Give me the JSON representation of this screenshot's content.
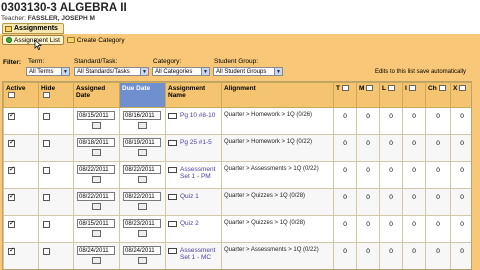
{
  "header": {
    "course_title": "0303130-3 ALGEBRA II",
    "teacher_label": "Teacher: ",
    "teacher_name": "FASSLER, JOSEPH M",
    "tab_label": "Assignments"
  },
  "toolbar": {
    "assignment_list_label": "Assignment List",
    "create_category_label": "Create Category"
  },
  "filters": {
    "filter_label": "Filter:",
    "term_label": "Term:",
    "term_value": "All Terms",
    "standard_label": "Standard/Task:",
    "standard_value": "All Standards/Tasks",
    "category_label": "Category:",
    "category_value": "All Categories",
    "group_label": "Student Group:",
    "group_value": "All Student Groups",
    "note": "Edits to this list save automatically"
  },
  "columns": {
    "active": "Active",
    "hide": "Hide",
    "assigned": "Assigned Date",
    "due": "Due Date",
    "assignment": "Assignment Name",
    "alignment": "Alignment",
    "t": "T",
    "m": "M",
    "l": "L",
    "i": "I",
    "ch": "Ch",
    "x": "X"
  },
  "rows": [
    {
      "active": true,
      "hide": false,
      "assigned": "08/15/2011",
      "due": "08/16/2011",
      "name": "Pg 10 #8-10",
      "alignment": "Quarter > Homework > 1Q (0/26)",
      "t": "0",
      "m": "0",
      "l": "0",
      "i": "0",
      "ch": "0",
      "x": "0"
    },
    {
      "active": true,
      "hide": false,
      "assigned": "08/18/2011",
      "due": "08/19/2011",
      "name": "Pg 25 #1-5",
      "alignment": "Quarter > Homework > 1Q (0/22)",
      "t": "0",
      "m": "0",
      "l": "0",
      "i": "0",
      "ch": "0",
      "x": "0"
    },
    {
      "active": true,
      "hide": false,
      "assigned": "08/22/2011",
      "due": "08/22/2011",
      "name": "Assessment Set 1 - PM",
      "alignment": "Quarter > Assessments > 1Q (0/22)",
      "t": "0",
      "m": "0",
      "l": "0",
      "i": "0",
      "ch": "0",
      "x": "0"
    },
    {
      "active": true,
      "hide": false,
      "assigned": "08/22/2011",
      "due": "08/22/2011",
      "name": "Quiz 1",
      "alignment": "Quarter > Quizzes > 1Q (0/28)",
      "t": "0",
      "m": "0",
      "l": "0",
      "i": "0",
      "ch": "0",
      "x": "0"
    },
    {
      "active": true,
      "hide": false,
      "assigned": "08/15/2011",
      "due": "08/23/2011",
      "name": "Quiz 2",
      "alignment": "Quarter > Quizzes > 1Q (0/28)",
      "t": "0",
      "m": "0",
      "l": "0",
      "i": "0",
      "ch": "0",
      "x": "0"
    },
    {
      "active": true,
      "hide": false,
      "assigned": "08/24/2011",
      "due": "08/24/2011",
      "name": "Assessment Set 1 - MC",
      "alignment": "Quarter > Assessments > 1Q (0/22)",
      "t": "0",
      "m": "0",
      "l": "0",
      "i": "0",
      "ch": "0",
      "x": "0"
    }
  ]
}
